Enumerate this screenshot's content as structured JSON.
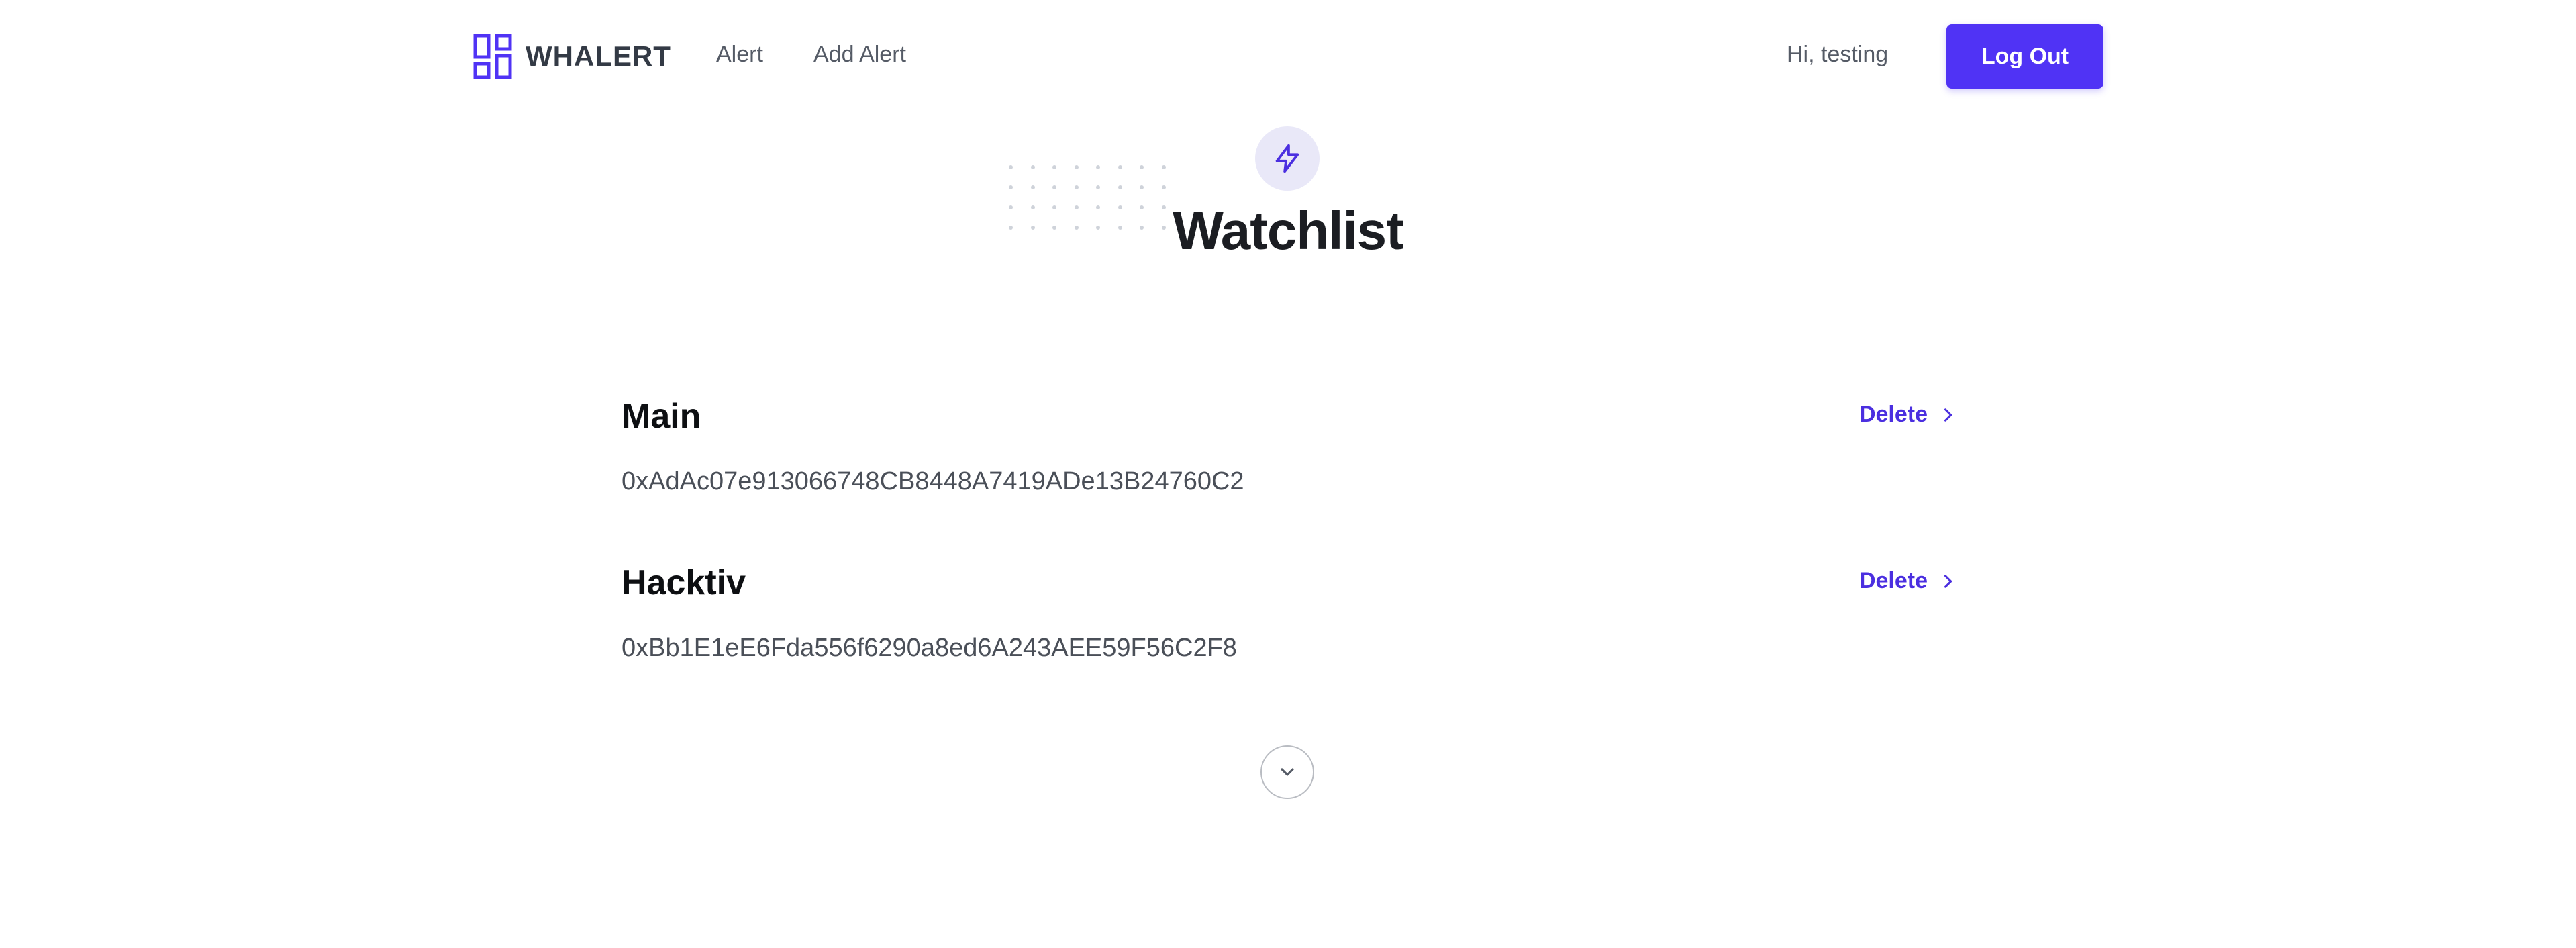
{
  "header": {
    "brand_name": "WHALERT",
    "logo_icon": "dashboard-grid-icon",
    "nav": [
      {
        "label": "Alert"
      },
      {
        "label": "Add Alert"
      }
    ],
    "greeting": "Hi, testing",
    "logout_label": "Log Out"
  },
  "hero": {
    "badge_icon": "lightning-bolt-icon",
    "title": "Watchlist"
  },
  "watchlist": [
    {
      "name": "Main",
      "address": "0xAdAc07e913066748CB8448A7419ADe13B24760C2",
      "action_label": "Delete"
    },
    {
      "name": "Hacktiv",
      "address": "0xBb1E1eE6Fda556f6290a8ed6A243AEE59F56C2F8",
      "action_label": "Delete"
    }
  ],
  "scroll_icon": "chevron-down-icon",
  "colors": {
    "accent": "#5033f5",
    "accent_text": "#4b2fe0",
    "badge_bg": "#e9e8f8",
    "title": "#1b1d22",
    "muted_text": "#555b66"
  }
}
